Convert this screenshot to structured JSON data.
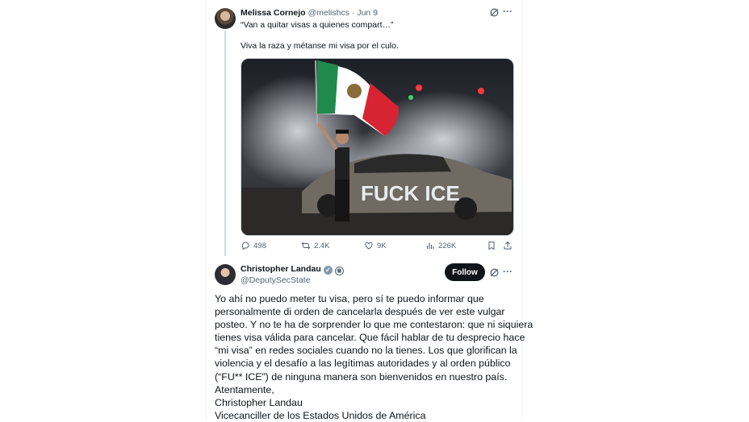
{
  "quoted_tweet": {
    "name": "Melissa Cornejo",
    "handle": "@melishcs",
    "sep": "·",
    "date": "Jun 9",
    "quote_line": "“Van a quitar visas a quienes compart…”",
    "text": "Viva la raza y métanse mi visa por el culo.",
    "image_graffiti": "FUCK ICE",
    "stats": {
      "replies": "498",
      "reposts": "2.4K",
      "likes": "9K",
      "views": "226K"
    }
  },
  "reply_tweet": {
    "name": "Christopher Landau",
    "handle": "@DeputySecState",
    "follow_label": "Follow",
    "body_lines": [
      "Yo ahí no puedo meter tu visa, pero sí te puedo informar que",
      "personalmente di orden de cancelarla después de ver este vulgar",
      "posteo. Y no te ha de sorprender lo que me contestaron: que ni siquiera",
      "tienes visa válida para cancelar. Que fácil hablar de tu desprecio hace",
      "“mi visa” en redes sociales cuando no la tienes. Los que glorifican la",
      "violencia y el desafío a las legítimas autoridades y al orden público",
      "(“FU** ICE”) de ninguna manera son bienvenidos en nuestro país.",
      "Atentamente,",
      "Christopher Landau",
      "Vicecanciller de los Estados Unidos de América"
    ]
  },
  "colors": {
    "muted": "#536471",
    "follow_bg": "#0f1419",
    "border": "#cfd9de"
  }
}
